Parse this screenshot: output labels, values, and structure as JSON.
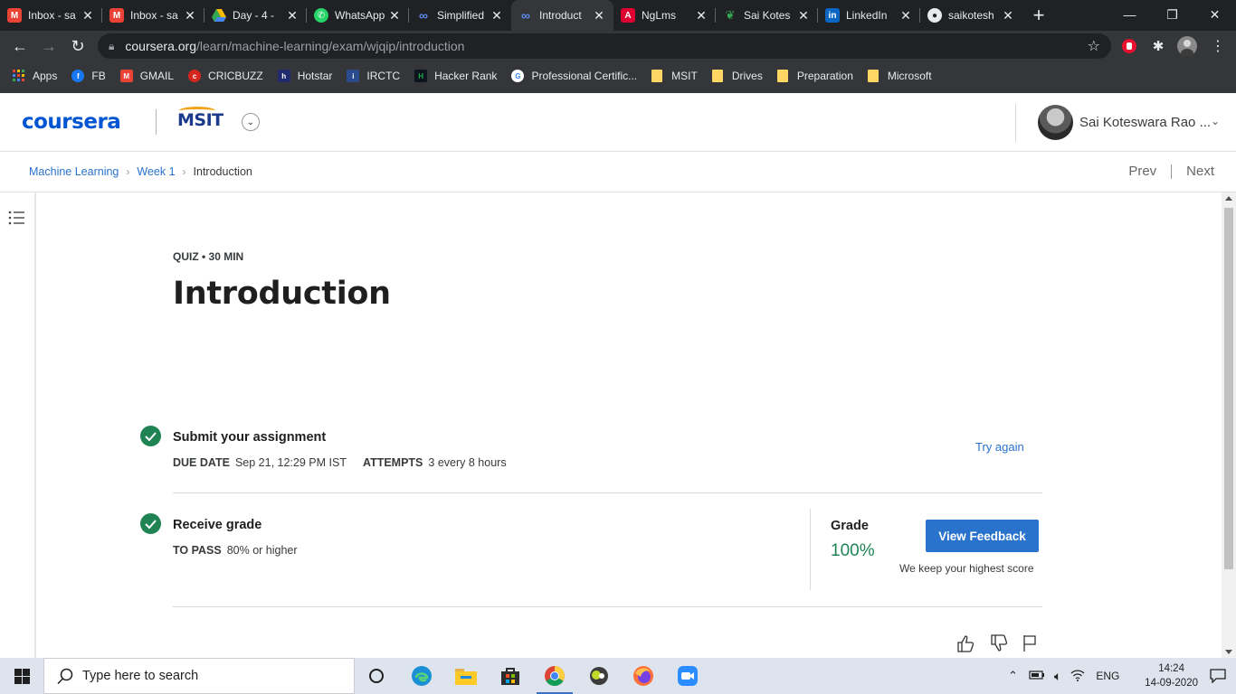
{
  "browser": {
    "tabs": [
      {
        "label": "Inbox - sa",
        "icon": "gmail-icon",
        "color": "#ea4335"
      },
      {
        "label": "Inbox - sa",
        "icon": "gmail-icon",
        "color": "#ea4335"
      },
      {
        "label": "Day - 4 - ",
        "icon": "google-drive-icon",
        "color": "#fbbc04"
      },
      {
        "label": "WhatsApp",
        "icon": "whatsapp-icon",
        "color": "#25d366"
      },
      {
        "label": "Simplified",
        "icon": "coursera-icon",
        "color": "#5b8def"
      },
      {
        "label": "Introduct",
        "icon": "coursera-icon",
        "color": "#5b8def",
        "active": true
      },
      {
        "label": "NgLms",
        "icon": "angular-icon",
        "color": "#dd0031"
      },
      {
        "label": "Sai Kotes",
        "icon": "leaf-icon",
        "color": "#34a853"
      },
      {
        "label": "LinkedIn",
        "icon": "linkedin-icon",
        "color": "#0a66c2"
      },
      {
        "label": "saikotesh",
        "icon": "github-icon",
        "color": "#e8eaed"
      }
    ],
    "url_host": "coursera.org",
    "url_path": "/learn/machine-learning/exam/wjqip/introduction",
    "bookmarks": [
      {
        "label": "Apps",
        "icon": "apps-grid-icon"
      },
      {
        "label": "FB",
        "icon": "facebook-icon",
        "color": "#1877f2"
      },
      {
        "label": "GMAIL",
        "icon": "gmail-icon",
        "color": "#ea4335"
      },
      {
        "label": "CRICBUZZ",
        "icon": "cricbuzz-icon",
        "color": "#d3261e"
      },
      {
        "label": "Hotstar",
        "icon": "hotstar-icon",
        "color": "#1f2b6c"
      },
      {
        "label": "IRCTC",
        "icon": "irctc-icon",
        "color": "#2a4b8d"
      },
      {
        "label": "Hacker Rank",
        "icon": "hackerrank-icon",
        "color": "#1ba94c"
      },
      {
        "label": "Professional Certific...",
        "icon": "google-icon",
        "color": "#ffffff"
      },
      {
        "label": "MSIT",
        "icon": "folder-icon"
      },
      {
        "label": "Drives",
        "icon": "folder-icon"
      },
      {
        "label": "Preparation",
        "icon": "folder-icon"
      },
      {
        "label": "Microsoft",
        "icon": "folder-icon"
      }
    ]
  },
  "header": {
    "logo": "coursera",
    "org_logo": "MSIT",
    "user_name": "Sai Koteswara Rao ..."
  },
  "breadcrumb": {
    "items": [
      "Machine Learning",
      "Week 1",
      "Introduction"
    ],
    "prev": "Prev",
    "next": "Next"
  },
  "quiz": {
    "eyebrow": "QUIZ • 30 MIN",
    "title": "Introduction",
    "submit": {
      "title": "Submit your assignment",
      "due_label": "DUE DATE",
      "due_value": "Sep 21, 12:29 PM IST",
      "attempts_label": "ATTEMPTS",
      "attempts_value": "3 every 8 hours",
      "action": "Try again"
    },
    "grade": {
      "title": "Receive grade",
      "pass_label": "TO PASS",
      "pass_value": "80% or higher",
      "grade_label": "Grade",
      "grade_value": "100%",
      "button": "View Feedback",
      "note": "We keep your highest score"
    }
  },
  "taskbar": {
    "search_placeholder": "Type here to search",
    "language": "ENG",
    "time": "14:24",
    "date": "14-09-2020"
  },
  "colors": {
    "accent": "#2a73cc",
    "success": "#1f8354",
    "coursera_blue": "#0056d2"
  }
}
